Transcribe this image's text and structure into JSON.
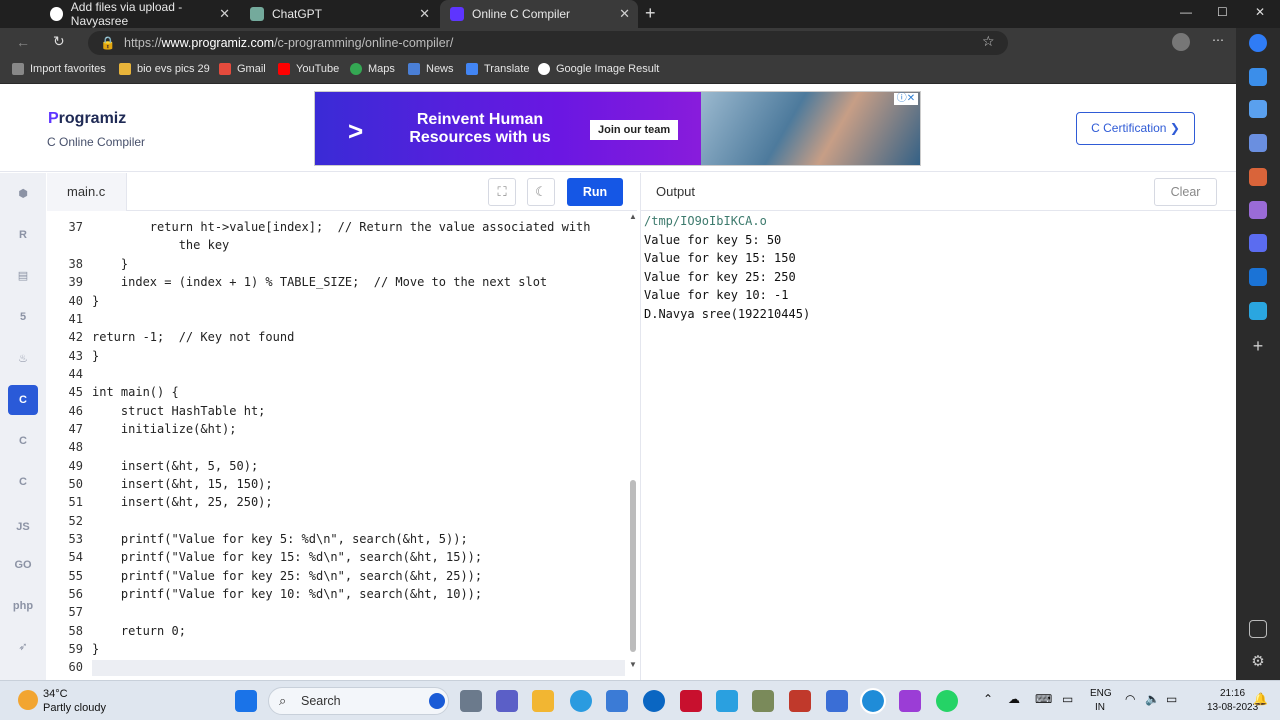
{
  "browser": {
    "tabs": [
      {
        "label": "Add files via upload - Navyasree",
        "icon": "github-icon"
      },
      {
        "label": "ChatGPT",
        "icon": "chatgpt-icon"
      },
      {
        "label": "Online C Compiler",
        "icon": "programiz-icon"
      }
    ],
    "url_prefix": "https://",
    "url_domain": "www.programiz.com",
    "url_path": "/c-programming/online-compiler/",
    "favorites": [
      "Import favorites",
      "bio evs pics 29",
      "Gmail",
      "YouTube",
      "Maps",
      "News",
      "Translate",
      "Google Image Result"
    ]
  },
  "site": {
    "logo_first": "P",
    "logo_rest": "rogramiz",
    "subtitle": "C Online Compiler",
    "ad_headline": "Reinvent Human Resources with us",
    "ad_button": "Join our team",
    "cert_button": "C Certification ❯"
  },
  "languages": [
    "python",
    "r",
    "sql",
    "html",
    "java",
    "c",
    "cpp",
    "csharp",
    "js",
    "go",
    "php",
    "swift"
  ],
  "editor": {
    "filename": "main.c",
    "run_label": "Run",
    "lines": [
      {
        "n": "37",
        "code": "        return ht->value[index];  // Return the value associated with"
      },
      {
        "n": "",
        "code": "            the key"
      },
      {
        "n": "38",
        "code": "    }"
      },
      {
        "n": "39",
        "code": "    index = (index + 1) % TABLE_SIZE;  // Move to the next slot"
      },
      {
        "n": "40",
        "code": "}"
      },
      {
        "n": "41",
        "code": ""
      },
      {
        "n": "42",
        "code": "return -1;  // Key not found"
      },
      {
        "n": "43",
        "code": "}"
      },
      {
        "n": "44",
        "code": ""
      },
      {
        "n": "45",
        "code": "int main() {"
      },
      {
        "n": "46",
        "code": "    struct HashTable ht;"
      },
      {
        "n": "47",
        "code": "    initialize(&ht);"
      },
      {
        "n": "48",
        "code": ""
      },
      {
        "n": "49",
        "code": "    insert(&ht, 5, 50);"
      },
      {
        "n": "50",
        "code": "    insert(&ht, 15, 150);"
      },
      {
        "n": "51",
        "code": "    insert(&ht, 25, 250);"
      },
      {
        "n": "52",
        "code": ""
      },
      {
        "n": "53",
        "code": "    printf(\"Value for key 5: %d\\n\", search(&ht, 5));"
      },
      {
        "n": "54",
        "code": "    printf(\"Value for key 15: %d\\n\", search(&ht, 15));"
      },
      {
        "n": "55",
        "code": "    printf(\"Value for key 25: %d\\n\", search(&ht, 25));"
      },
      {
        "n": "56",
        "code": "    printf(\"Value for key 10: %d\\n\", search(&ht, 10));"
      },
      {
        "n": "57",
        "code": ""
      },
      {
        "n": "58",
        "code": "    return 0;"
      },
      {
        "n": "59",
        "code": "}"
      },
      {
        "n": "60",
        "code": ""
      }
    ]
  },
  "output": {
    "label": "Output",
    "clear_label": "Clear",
    "lines": [
      "/tmp/IO9oIbIKCA.o",
      "Value for key 5: 50",
      "Value for key 15: 150",
      "Value for key 25: 250",
      "Value for key 10: -1",
      "D.Navya sree(192210445)"
    ]
  },
  "taskbar": {
    "weather_temp": "34°C",
    "weather_desc": "Partly cloudy",
    "search_placeholder": "Search",
    "lang_top": "ENG",
    "lang_bottom": "IN",
    "time": "21:16",
    "date": "13-08-2023"
  }
}
